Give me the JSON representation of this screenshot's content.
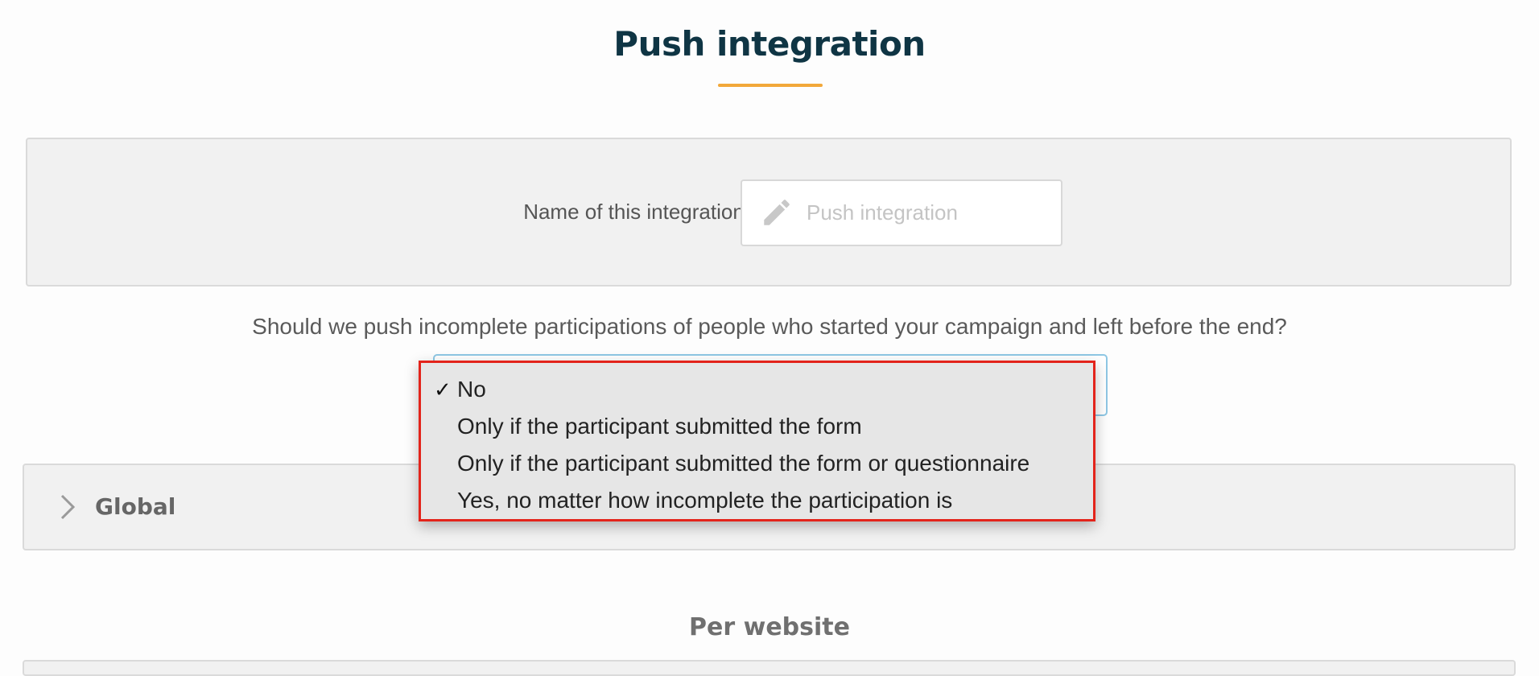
{
  "header": {
    "title": "Push integration",
    "accent_color": "#f2a83a"
  },
  "name_section": {
    "label": "Name of this integration:",
    "input_placeholder": "Push integration",
    "input_icon": "pencil-icon"
  },
  "incomplete_question": {
    "text": "Should we push incomplete participations of people who started your campaign and left before the end?",
    "dropdown": {
      "selected_index": 0,
      "check_symbol": "✓",
      "options": [
        {
          "label": "No",
          "selected": true
        },
        {
          "label": "Only if the participant submitted the form",
          "selected": false
        },
        {
          "label": "Only if the participant submitted the form or questionnaire",
          "selected": false
        },
        {
          "label": "Yes, no matter how incomplete the participation is",
          "selected": false
        }
      ],
      "highlight_color": "#e3241b"
    }
  },
  "sections": {
    "global_label": "Global",
    "global_icon": "chevron-right-icon",
    "per_website_label": "Per website"
  }
}
